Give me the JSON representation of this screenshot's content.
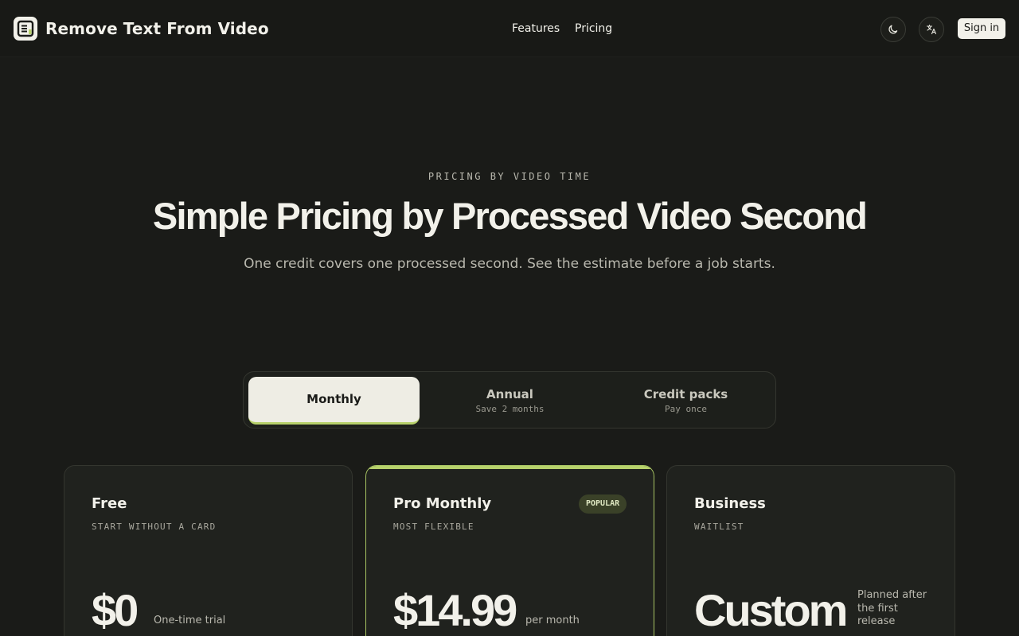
{
  "header": {
    "brand": "Remove Text From Video",
    "nav": {
      "features": "Features",
      "pricing": "Pricing"
    },
    "signin": "Sign in",
    "icons": {
      "logo": "document-logo-icon",
      "theme": "moon-icon",
      "language": "translate-icon"
    }
  },
  "hero": {
    "eyebrow": "PRICING BY VIDEO TIME",
    "title": "Simple Pricing by Processed Video Second",
    "subtitle": "One credit covers one processed second. See the estimate before a job starts."
  },
  "billing": {
    "options": [
      {
        "label": "Monthly",
        "sub": "",
        "active": true
      },
      {
        "label": "Annual",
        "sub": "Save 2 months",
        "active": false
      },
      {
        "label": "Credit packs",
        "sub": "Pay once",
        "active": false
      }
    ]
  },
  "plans": [
    {
      "name": "Free",
      "tag": "START WITHOUT A CARD",
      "price": "$0",
      "note": "One-time trial"
    },
    {
      "name": "Pro Monthly",
      "tag": "MOST FLEXIBLE",
      "badge": "POPULAR",
      "price": "$14.99",
      "note": "per month"
    },
    {
      "name": "Business",
      "tag": "WAITLIST",
      "price": "Custom",
      "note": "Planned after the first release"
    }
  ],
  "colors": {
    "background": "#1a1b18",
    "accent": "#b7d16b",
    "text": "#f2f1ea"
  }
}
